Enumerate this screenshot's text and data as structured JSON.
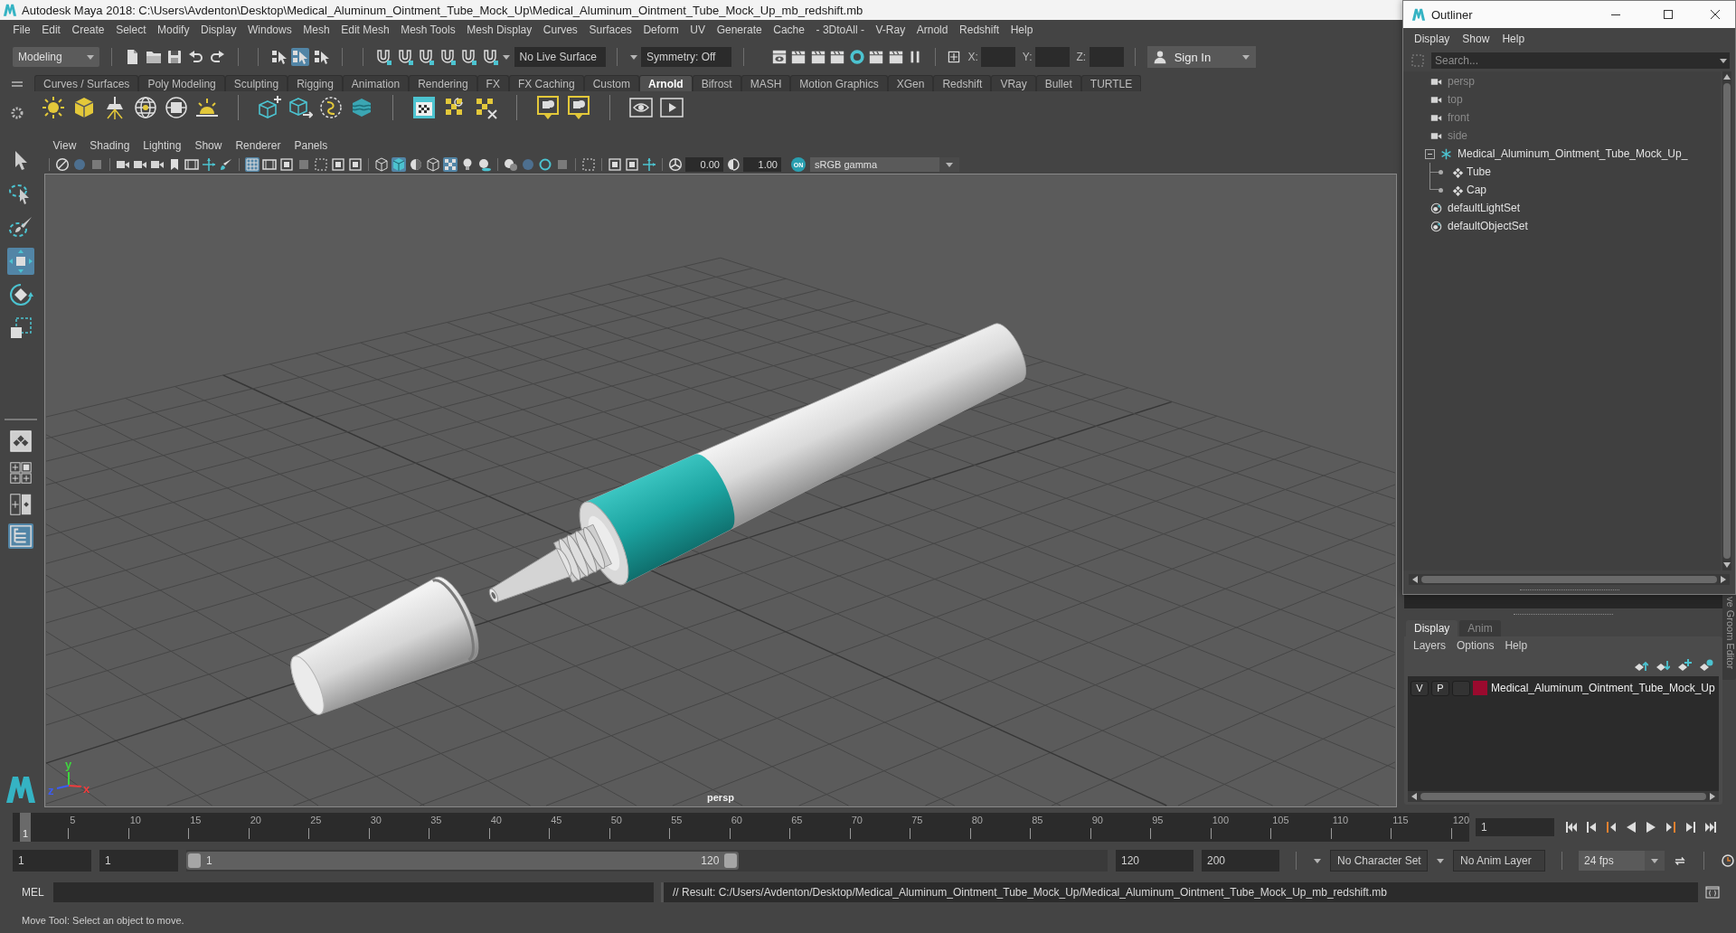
{
  "window": {
    "title": "Autodesk Maya 2018: C:\\Users\\Avdenton\\Desktop\\Medical_Aluminum_Ointment_Tube_Mock_Up\\Medical_Aluminum_Ointment_Tube_Mock_Up_mb_redshift.mb"
  },
  "menu_bar": [
    "File",
    "Edit",
    "Create",
    "Select",
    "Modify",
    "Display",
    "Windows",
    "Mesh",
    "Edit Mesh",
    "Mesh Tools",
    "Mesh Display",
    "Curves",
    "Surfaces",
    "Deform",
    "UV",
    "Generate",
    "Cache",
    "- 3DtoAll -",
    "V-Ray",
    "Arnold",
    "Redshift",
    "Help"
  ],
  "status_line": {
    "menu_set": "Modeling",
    "select_modes": [
      {
        "selected": false
      },
      {
        "selected": true
      },
      {
        "selected": false
      }
    ],
    "live_surface": "No Live Surface",
    "symmetry": "Symmetry: Off",
    "coordinates": [
      {
        "label": "X:"
      },
      {
        "label": "Y:"
      },
      {
        "label": "Z:"
      }
    ],
    "sign_in": "Sign In"
  },
  "shelf": {
    "tabs": [
      {
        "label": "Curves / Surfaces",
        "selected": false
      },
      {
        "label": "Poly Modeling",
        "selected": false
      },
      {
        "label": "Sculpting",
        "selected": false
      },
      {
        "label": "Rigging",
        "selected": false
      },
      {
        "label": "Animation",
        "selected": false
      },
      {
        "label": "Rendering",
        "selected": false
      },
      {
        "label": "FX",
        "selected": false
      },
      {
        "label": "FX Caching",
        "selected": false
      },
      {
        "label": "Custom",
        "selected": false
      },
      {
        "label": "Arnold",
        "selected": true
      },
      {
        "label": "Bifrost",
        "selected": false
      },
      {
        "label": "MASH",
        "selected": false
      },
      {
        "label": "Motion Graphics",
        "selected": false
      },
      {
        "label": "XGen",
        "selected": false
      },
      {
        "label": "Redshift",
        "selected": false
      },
      {
        "label": "VRay",
        "selected": false
      },
      {
        "label": "Bullet",
        "selected": false
      },
      {
        "label": "TURTLE",
        "selected": false
      }
    ]
  },
  "toolbox": {
    "tools": [
      {
        "selected": false
      },
      {
        "selected": false
      },
      {
        "selected": false
      },
      {
        "selected": true
      },
      {
        "selected": false
      },
      {
        "selected": false
      }
    ],
    "layouts": [
      {
        "selected": false
      },
      {
        "selected": false
      },
      {
        "selected": false
      },
      {
        "selected": true
      }
    ]
  },
  "viewport": {
    "menus": [
      "View",
      "Shading",
      "Lighting",
      "Show",
      "Renderer",
      "Panels"
    ],
    "toolbar_toggles": [
      {
        "on": false
      },
      {
        "on": false
      },
      {
        "on": false
      },
      {
        "on": false
      },
      {
        "on": false
      },
      {
        "on": false
      },
      {
        "on": false
      },
      {
        "on": false
      },
      {
        "on": false
      },
      {
        "on": false
      },
      {
        "on": true
      },
      {
        "on": false
      },
      {
        "on": false
      },
      {
        "on": false
      },
      {
        "on": false
      },
      {
        "on": false
      },
      {
        "on": false
      },
      {
        "on": false
      },
      {
        "on": true
      },
      {
        "on": false
      },
      {
        "on": false
      },
      {
        "on": true
      },
      {
        "on": false
      },
      {
        "on": false
      },
      {
        "on": false
      },
      {
        "on": false
      },
      {
        "on": false
      },
      {
        "on": false
      },
      {
        "on": false
      },
      {
        "on": false
      },
      {
        "on": false
      },
      {
        "on": false
      }
    ],
    "exposure": "0.00",
    "gamma": "1.00",
    "color_management": "ON",
    "color_space": "sRGB gamma",
    "camera": "persp",
    "axes": [
      {
        "label": "y",
        "color": "#3fd43f"
      },
      {
        "label": "z",
        "color": "#3c5cf5"
      },
      {
        "label": "x",
        "color": "#f03c3c"
      }
    ]
  },
  "timeline": {
    "frame_labels": [
      "5",
      "10",
      "15",
      "20",
      "25",
      "30",
      "35",
      "40",
      "45",
      "50",
      "55",
      "60",
      "65",
      "70",
      "75",
      "80",
      "85",
      "90",
      "95",
      "100",
      "105",
      "110",
      "115",
      "120"
    ],
    "current_frame": "1",
    "frame_field": "1"
  },
  "range_slider": {
    "start_field": "1",
    "range_start_field": "1",
    "range_start": "1",
    "range_end": "120",
    "level": 0.6,
    "range_end_field": "120",
    "end_field": "200"
  },
  "anim_controls": {
    "character_set": "No Character Set",
    "anim_layer": "No Anim Layer",
    "fps": "24 fps"
  },
  "command_line": {
    "language": "MEL",
    "result": "// Result: C:/Users/Avdenton/Desktop/Medical_Aluminum_Ointment_Tube_Mock_Up/Medical_Aluminum_Ointment_Tube_Mock_Up_mb_redshift.mb"
  },
  "help_line": "Move Tool: Select an object to move.",
  "outliner": {
    "title": "Outliner",
    "menus": [
      "Display",
      "Show",
      "Help"
    ],
    "search": {
      "placeholder": "Search..."
    },
    "items": [
      {
        "label": "persp",
        "kind": "camera",
        "dimmed": true
      },
      {
        "label": "top",
        "kind": "camera",
        "dimmed": true
      },
      {
        "label": "front",
        "kind": "camera",
        "dimmed": true
      },
      {
        "label": "side",
        "kind": "camera",
        "dimmed": true
      },
      {
        "label": "Medical_Aluminum_Ointment_Tube_Mock_Up_",
        "kind": "group",
        "dimmed": false,
        "expanded": true,
        "children": [
          {
            "label": "Tube",
            "kind": "mesh",
            "dimmed": false
          },
          {
            "label": "Cap",
            "kind": "mesh",
            "dimmed": false
          }
        ]
      },
      {
        "label": "defaultLightSet",
        "kind": "set",
        "dimmed": false
      },
      {
        "label": "defaultObjectSet",
        "kind": "set",
        "dimmed": false
      }
    ]
  },
  "layer_editor": {
    "tabs": [
      {
        "label": "Display",
        "selected": true
      },
      {
        "label": "Anim",
        "selected": false
      }
    ],
    "menus": [
      "Layers",
      "Options",
      "Help"
    ],
    "layers": [
      {
        "visibility": "V",
        "playback": "P",
        "color": "#9a0a2e",
        "name": "Medical_Aluminum_Ointment_Tube_Mock_Up"
      }
    ],
    "side_tab": "ve Groom Editor"
  }
}
